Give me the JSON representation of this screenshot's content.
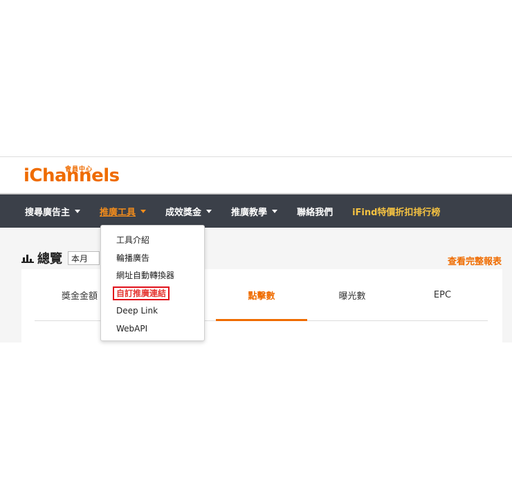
{
  "brand": {
    "subtitle": "會員中心",
    "name": "iChannels"
  },
  "nav": {
    "items": [
      {
        "label": "搜尋廣告主",
        "has_caret": true,
        "active": false
      },
      {
        "label": "推廣工具",
        "has_caret": true,
        "active": true
      },
      {
        "label": "成效獎金",
        "has_caret": true,
        "active": false
      },
      {
        "label": "推廣教學",
        "has_caret": true,
        "active": false
      },
      {
        "label": "聯絡我們",
        "has_caret": false,
        "active": false
      },
      {
        "label": "iFind特價折扣排行榜",
        "has_caret": false,
        "active": false
      }
    ]
  },
  "dropdown": {
    "items": [
      {
        "label": "工具介紹"
      },
      {
        "label": "輪播廣告"
      },
      {
        "label": "網址自動轉換器"
      },
      {
        "label": "自訂推廣連結",
        "highlighted": true
      },
      {
        "label": "Deep Link"
      },
      {
        "label": "WebAPI"
      }
    ]
  },
  "overview": {
    "title": "總覽",
    "period": "本月",
    "full_report_link": "查看完整報表"
  },
  "stats": {
    "tabs": [
      {
        "label": "獎金金額"
      },
      {
        "label": "點擊數",
        "active": true
      },
      {
        "label": "曝光數"
      },
      {
        "label": "EPC"
      }
    ]
  },
  "colors": {
    "accent": "#ef6c00",
    "navbar_bg": "#3b4049",
    "highlight_border": "#e0101a"
  }
}
